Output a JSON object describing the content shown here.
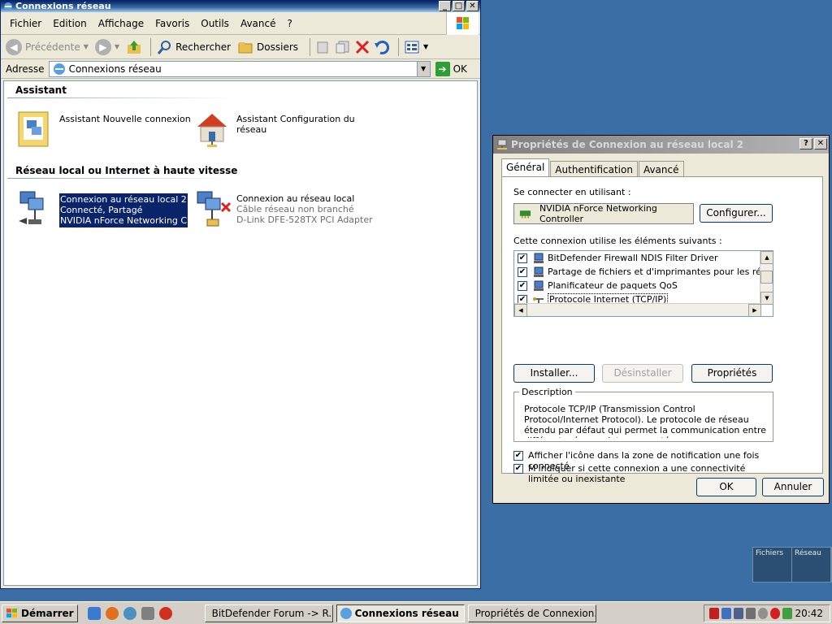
{
  "explorer": {
    "title": "Connexions réseau",
    "menu": [
      "Fichier",
      "Edition",
      "Affichage",
      "Favoris",
      "Outils",
      "Avancé",
      "?"
    ],
    "toolbar": {
      "back": "Précédente",
      "search": "Rechercher",
      "folders": "Dossiers"
    },
    "address": {
      "label": "Adresse",
      "value": "Connexions réseau",
      "go": "OK"
    },
    "sections": [
      {
        "title": "Assistant",
        "items": [
          {
            "lines": [
              "Assistant Nouvelle connexion"
            ]
          },
          {
            "lines": [
              "Assistant Configuration du",
              "réseau"
            ]
          }
        ]
      },
      {
        "title": "Réseau local ou Internet à haute vitesse",
        "items": [
          {
            "lines": [
              "Connexion au réseau local 2",
              "Connecté, Partagé",
              "NVIDIA nForce Networking Co..."
            ]
          },
          {
            "lines": [
              "Connexion au réseau local",
              "Câble réseau non branché",
              "D-Link DFE-528TX PCI Adapter"
            ]
          }
        ]
      }
    ]
  },
  "dialog": {
    "title": "Propriétés de Connexion au réseau local 2",
    "title_buttons": [
      "?",
      "✕"
    ],
    "tabs": [
      "Général",
      "Authentification",
      "Avancé"
    ],
    "connect_label": "Se connecter en utilisant :",
    "device": "NVIDIA nForce Networking Controller",
    "configure": "Configurer...",
    "components_label": "Cette connexion utilise les éléments suivants :",
    "components": [
      {
        "label": "BitDefender Firewall NDIS Filter Driver",
        "checked": "✔"
      },
      {
        "label": "Partage de fichiers et d'imprimantes pour les réseaux M",
        "checked": "✔"
      },
      {
        "label": "Planificateur de paquets QoS",
        "checked": "✔"
      },
      {
        "label": "Protocole Internet (TCP/IP)",
        "checked": "✔"
      }
    ],
    "buttons": {
      "install": "Installer...",
      "uninstall": "Désinstaller",
      "properties": "Propriétés"
    },
    "description_label": "Description",
    "description": "Protocole TCP/IP (Transmission Control Protocol/Internet Protocol). Le protocole de réseau étendu par défaut qui permet la communication entre différents réseaux interconnectés.",
    "checkboxes": [
      {
        "label": "Afficher l'icône dans la zone de notification une fois connecté",
        "checked": "✔"
      },
      {
        "label": "M'indiquer si cette connexion a une connectivité limitée ou inexistante",
        "checked": "✔"
      }
    ],
    "ok": "OK",
    "cancel": "Annuler"
  },
  "desktop_widget": {
    "col1": "Fichiers",
    "col2": "Réseau"
  },
  "taskbar": {
    "start": "Démarrer",
    "tasks": [
      "BitDefender Forum -> R...",
      "Connexions réseau",
      "Propriétés de Connexion..."
    ],
    "clock": "20:42"
  }
}
